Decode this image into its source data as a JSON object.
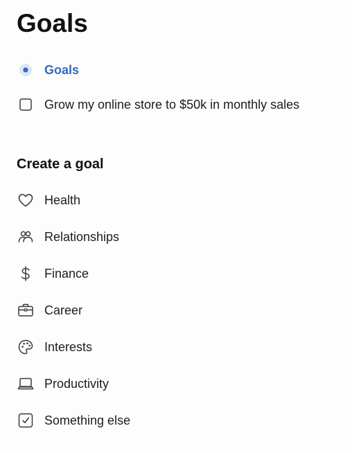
{
  "header": {
    "title": "Goals"
  },
  "goals": {
    "heading": "Goals",
    "items": [
      {
        "label": "Grow my online store to $50k in monthly sales",
        "checked": false
      }
    ]
  },
  "create": {
    "title": "Create a goal",
    "categories": [
      {
        "label": "Health",
        "icon": "heart-icon"
      },
      {
        "label": "Relationships",
        "icon": "people-icon"
      },
      {
        "label": "Finance",
        "icon": "dollar-icon"
      },
      {
        "label": "Career",
        "icon": "briefcase-icon"
      },
      {
        "label": "Interests",
        "icon": "palette-icon"
      },
      {
        "label": "Productivity",
        "icon": "laptop-icon"
      },
      {
        "label": "Something else",
        "icon": "checkbox-check-icon"
      }
    ]
  },
  "colors": {
    "accent": "#2f6dba",
    "accent_dot_bg": "#dbe7f7",
    "text": "#1c1c1e",
    "icon": "#3a3a3c"
  }
}
